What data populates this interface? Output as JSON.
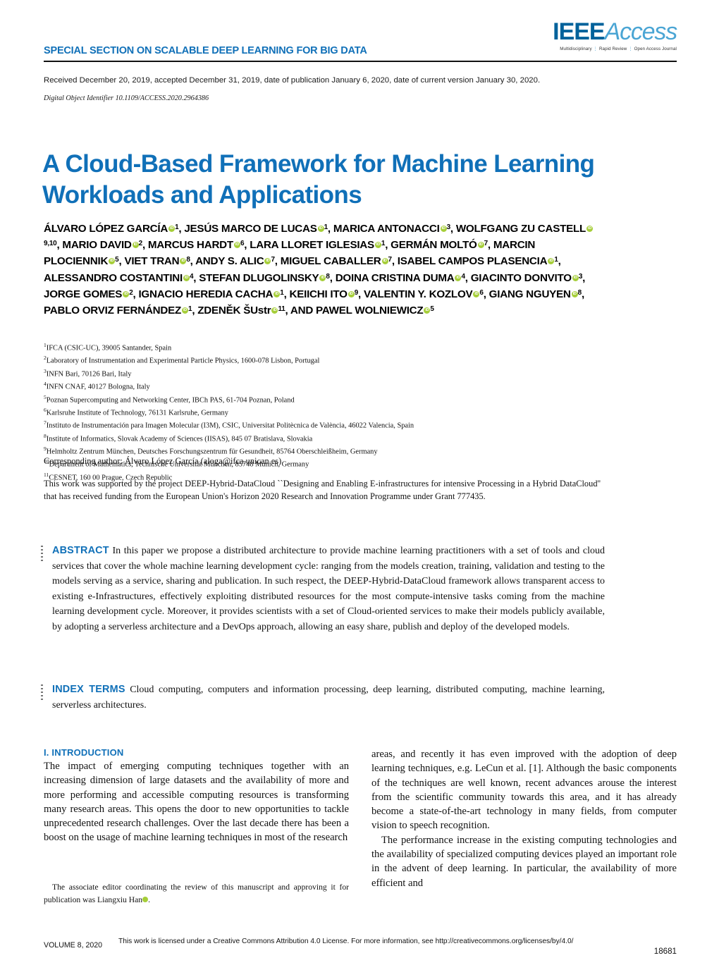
{
  "masthead": {
    "special_section": "SPECIAL SECTION ON SCALABLE DEEP LEARNING FOR BIG DATA",
    "logo_ieee": "IEEE",
    "logo_access": "Access",
    "logo_tagline_1": "Multidisciplinary",
    "logo_tagline_2": "Rapid Review",
    "logo_tagline_3": "Open Access Journal",
    "accent_blue": "#1070b8",
    "logo_blue_dark": "#00629b",
    "logo_blue_light": "#4aa5d4"
  },
  "dates": {
    "received_line": "Received December 20, 2019, accepted December 31, 2019, date of publication January 6, 2020, date of current version January 30, 2020.",
    "doi": "Digital Object Identifier 10.1109/ACCESS.2020.2964386"
  },
  "article": {
    "title": "A Cloud-Based Framework for Machine Learning Workloads and Applications"
  },
  "authors": {
    "orcid_label": "iD",
    "list": [
      {
        "name": "ÁLVARO LÓPEZ GARCÍA",
        "orcid": true,
        "affil": "1",
        "sep": ", "
      },
      {
        "name": "JESÚS MARCO DE LUCAS",
        "orcid": true,
        "affil": "1",
        "sep": ", "
      },
      {
        "name": "MARICA ANTONACCI",
        "orcid": true,
        "affil": "3",
        "sep": ", "
      },
      {
        "name": "WOLFGANG ZU CASTELL",
        "orcid": true,
        "affil": "9,10",
        "sep": ", "
      },
      {
        "name": "MARIO DAVID",
        "orcid": true,
        "affil": "2",
        "sep": ", "
      },
      {
        "name": "MARCUS HARDT",
        "orcid": true,
        "affil": "6",
        "sep": ", "
      },
      {
        "name": "LARA LLORET IGLESIAS",
        "orcid": true,
        "affil": "1",
        "sep": ", "
      },
      {
        "name": "GERMÁN MOLTÓ",
        "orcid": true,
        "affil": "7",
        "sep": ", "
      },
      {
        "name": "MARCIN PLOCIENNIK",
        "orcid": true,
        "affil": "5",
        "sep": ", "
      },
      {
        "name": "VIET TRAN",
        "orcid": true,
        "affil": "8",
        "sep": ", "
      },
      {
        "name": "ANDY S. ALIC",
        "orcid": true,
        "affil": "7",
        "sep": ", "
      },
      {
        "name": "MIGUEL CABALLER",
        "orcid": true,
        "affil": "7",
        "sep": ", "
      },
      {
        "name": "ISABEL CAMPOS PLASENCIA",
        "orcid": true,
        "affil": "1",
        "sep": ", "
      },
      {
        "name": "ALESSANDRO COSTANTINI",
        "orcid": true,
        "affil": "4",
        "sep": ", "
      },
      {
        "name": "STEFAN DLUGOLINSKY",
        "orcid": true,
        "affil": "8",
        "sep": ", "
      },
      {
        "name": "DOINA CRISTINA DUMA",
        "orcid": true,
        "affil": "4",
        "sep": ", "
      },
      {
        "name": "GIACINTO DONVITO",
        "orcid": true,
        "affil": "3",
        "sep": ", "
      },
      {
        "name": "JORGE GOMES",
        "orcid": true,
        "affil": "2",
        "sep": ", "
      },
      {
        "name": "IGNACIO HEREDIA CACHA",
        "orcid": true,
        "affil": "1",
        "sep": ", "
      },
      {
        "name": "KEIICHI ITO",
        "orcid": true,
        "affil": "9",
        "sep": ", "
      },
      {
        "name": "VALENTIN Y. KOZLOV",
        "orcid": true,
        "affil": "6",
        "sep": ", "
      },
      {
        "name": "GIANG NGUYEN",
        "orcid": true,
        "affil": "8",
        "sep": ", "
      },
      {
        "name": "PABLO ORVIZ FERNÁNDEZ",
        "orcid": true,
        "affil": "1",
        "sep": ", "
      },
      {
        "name": "ZDENĚK ŠUstr",
        "orcid": true,
        "affil": "11",
        "sep": ", AND "
      },
      {
        "name": "PAWEL WOLNIEWICZ",
        "orcid": true,
        "affil": "5",
        "sep": ""
      }
    ]
  },
  "affiliations": [
    {
      "num": "1",
      "text": "IFCA (CSIC-UC), 39005 Santander, Spain"
    },
    {
      "num": "2",
      "text": "Laboratory of Instrumentation and Experimental Particle Physics, 1600-078 Lisbon, Portugal"
    },
    {
      "num": "3",
      "text": "INFN Bari, 70126 Bari, Italy"
    },
    {
      "num": "4",
      "text": "INFN CNAF, 40127 Bologna, Italy"
    },
    {
      "num": "5",
      "text": "Poznan Supercomputing and Networking Center, IBCh PAS, 61-704 Poznan, Poland"
    },
    {
      "num": "6",
      "text": "Karlsruhe Institute of Technology, 76131 Karlsruhe, Germany"
    },
    {
      "num": "7",
      "text": "Instituto de Instrumentación para Imagen Molecular (I3M), CSIC, Universitat Politècnica de València, 46022 Valencia, Spain"
    },
    {
      "num": "8",
      "text": "Institute of Informatics, Slovak Academy of Sciences (IISAS), 845 07 Bratislava, Slovakia"
    },
    {
      "num": "9",
      "text": "Helmholtz Zentrum München, Deutsches Forschungszentrum für Gesundheit, 85764 Oberschleißheim, Germany"
    },
    {
      "num": "10",
      "text": "Department of Mathematics, Technische Universität München, 85748 Munich, Germany"
    },
    {
      "num": "11",
      "text": "CESNET, 160 00 Prague, Czech Republic"
    }
  ],
  "notes": {
    "corresponding": "Corresponding author: Álvaro López García (aloga@ifca.unican.es)",
    "funding": "This work was supported by the project DEEP-Hybrid-DataCloud ``Designing and Enabling E-infrastructures for intensive Processing in a Hybrid DataCloud'' that has received funding from the European Union's Horizon 2020 Research and Innovation Programme under Grant 777435."
  },
  "abstract": {
    "label": "ABSTRACT",
    "text": "In this paper we propose a distributed architecture to provide machine learning practitioners with a set of tools and cloud services that cover the whole machine learning development cycle: ranging from the models creation, training, validation and testing to the models serving as a service, sharing and publication. In such respect, the DEEP-Hybrid-DataCloud framework allows transparent access to existing e-Infrastructures, effectively exploiting distributed resources for the most compute-intensive tasks coming from the machine learning development cycle. Moreover, it provides scientists with a set of Cloud-oriented services to make their models publicly available, by adopting a serverless architecture and a DevOps approach, allowing an easy share, publish and deploy of the developed models."
  },
  "index_terms": {
    "label": "INDEX TERMS",
    "text": "Cloud computing, computers and information processing, deep learning, distributed computing, machine learning, serverless architectures."
  },
  "body": {
    "section_heading": "I. INTRODUCTION",
    "left_paragraph": "The impact of emerging computing techniques together with an increasing dimension of large datasets and the availability of more and more performing and accessible computing resources is transforming many research areas. This opens the door to new opportunities to tackle unprecedented research challenges. Over the last decade there has been a boost on the usage of machine learning techniques in most of the research",
    "right_paragraph_1": "areas, and recently it has even improved with the adoption of deep learning techniques, e.g. LeCun et al. [1]. Although the basic components of the techniques are well known, recent advances arouse the interest from the scientific community towards this area, and it has already become a state-of-the-art technology in many fields, from computer vision to speech recognition.",
    "right_paragraph_2": "The performance increase in the existing computing technologies and the availability of specialized computing devices played an important role in the advent of deep learning. In particular, the availability of more efficient and",
    "footnote_part_1": "The associate editor coordinating the review of this manuscript and approving it for publication was Liangxiu Han",
    "footnote_part_2": "."
  },
  "footer": {
    "volume": "VOLUME 8, 2020",
    "license": "This work is licensed under a Creative Commons Attribution 4.0 License. For more information, see http://creativecommons.org/licenses/by/4.0/",
    "page_number": "18681"
  }
}
